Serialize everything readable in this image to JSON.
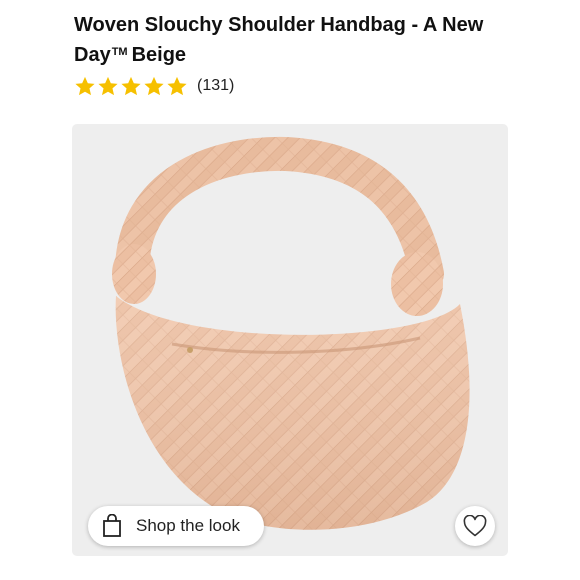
{
  "product": {
    "title_main": "Woven Slouchy Shoulder Handbag - A New Day",
    "title_tm": "TM",
    "title_suffix": "Beige",
    "rating": {
      "stars": 5,
      "max": 5,
      "count_label": "(131)"
    }
  },
  "image": {
    "subject": "beige woven slouchy shoulder handbag",
    "bag_color": "#f1c8ad",
    "background_color": "#eeeeee"
  },
  "actions": {
    "shop_the_look_label": "Shop the look",
    "shop_icon": "shopping-bag-icon",
    "favorite_icon": "heart-icon"
  },
  "colors": {
    "star": "#f6c000",
    "text": "#111111"
  }
}
